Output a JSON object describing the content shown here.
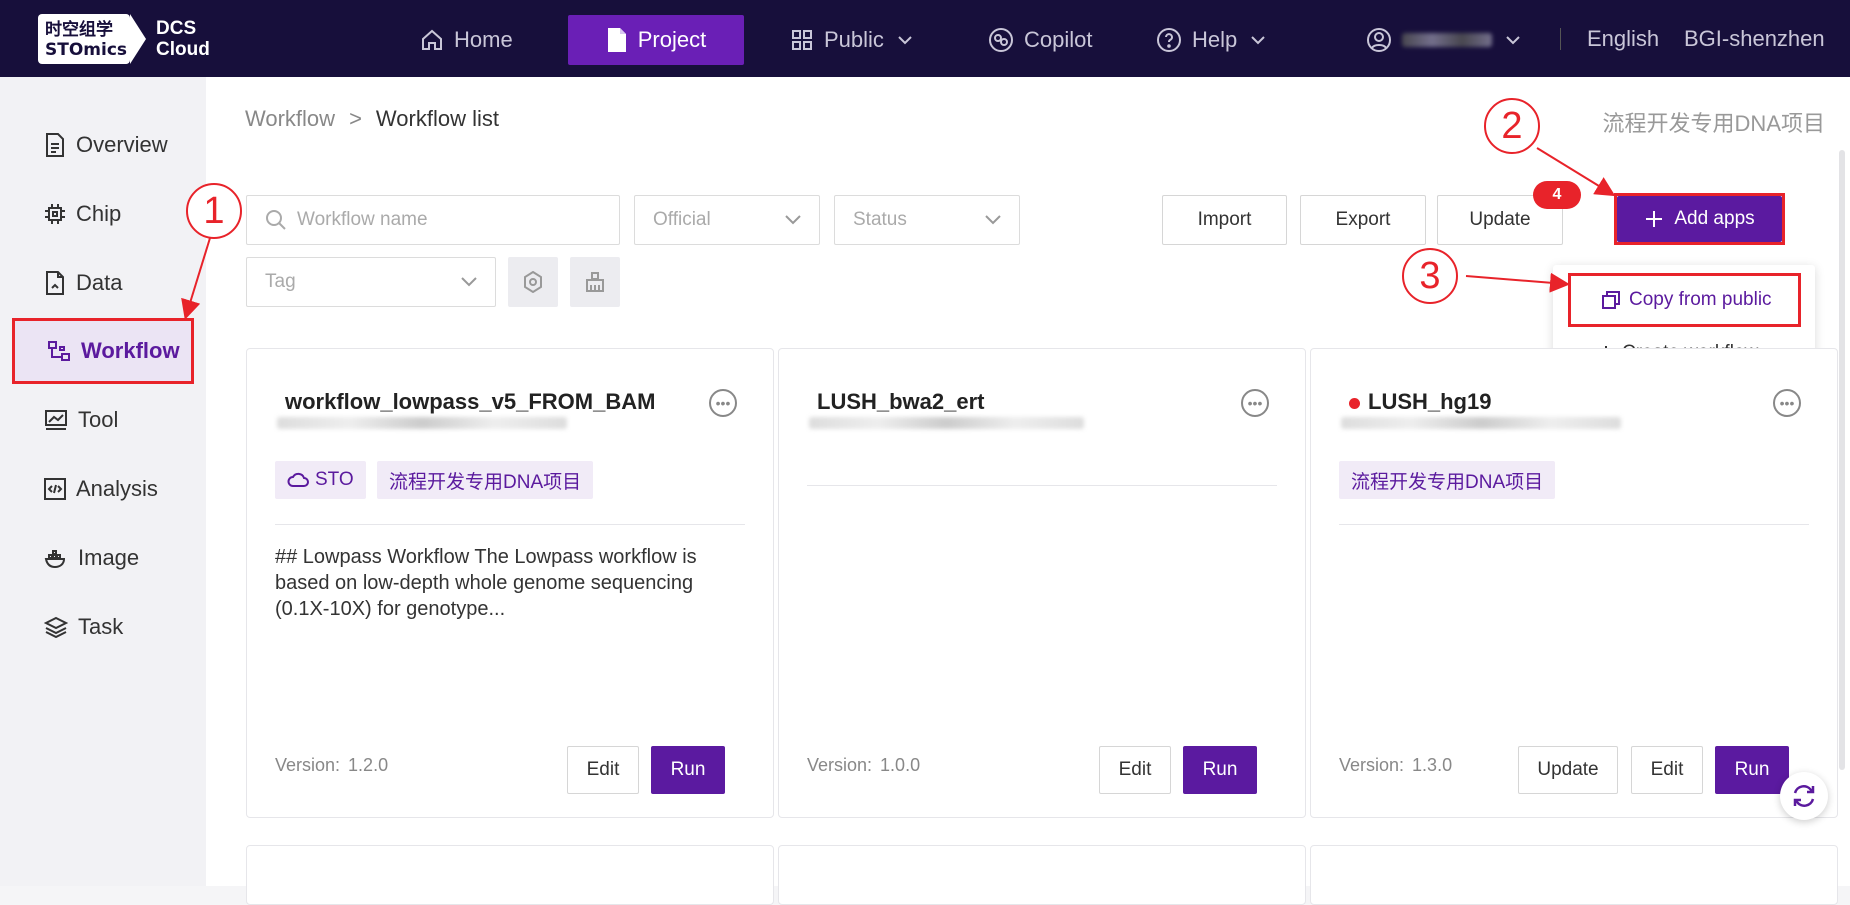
{
  "logo": {
    "cn": "时空组学",
    "en": "STOmics",
    "product_line1": "DCS",
    "product_line2": "Cloud"
  },
  "nav": {
    "home": "Home",
    "project": "Project",
    "public": "Public",
    "copilot": "Copilot",
    "help": "Help",
    "language": "English",
    "org": "BGI-shenzhen"
  },
  "sidebar": {
    "items": [
      {
        "label": "Overview"
      },
      {
        "label": "Chip"
      },
      {
        "label": "Data"
      },
      {
        "label": "Workflow"
      },
      {
        "label": "Tool"
      },
      {
        "label": "Analysis"
      },
      {
        "label": "Image"
      },
      {
        "label": "Task"
      }
    ]
  },
  "breadcrumb": {
    "parent": "Workflow",
    "separator": ">",
    "current": "Workflow list"
  },
  "project_name": "流程开发专用DNA项目",
  "filters": {
    "search_placeholder": "Workflow name",
    "official": "Official",
    "status": "Status",
    "tag": "Tag"
  },
  "toolbar": {
    "import": "Import",
    "export": "Export",
    "update": "Update",
    "update_badge": "4",
    "add_apps": "Add apps"
  },
  "add_menu": {
    "copy_from_public": "Copy from public",
    "create_workflow": "Create workflow"
  },
  "callouts": [
    "1",
    "2",
    "3"
  ],
  "cards": [
    {
      "title": "workflow_lowpass_v5_FROM_BAM",
      "tags": [
        "STO",
        "流程开发专用DNA项目"
      ],
      "description": "## Lowpass Workflow The Lowpass workflow is based on low-depth whole genome sequencing (0.1X-10X) for genotype...",
      "version_label": "Version:",
      "version": "1.2.0",
      "edit": "Edit",
      "run": "Run"
    },
    {
      "title": "LUSH_bwa2_ert",
      "version_label": "Version:",
      "version": "1.0.0",
      "edit": "Edit",
      "run": "Run"
    },
    {
      "title": "LUSH_hg19",
      "tags": [
        "流程开发专用DNA项目"
      ],
      "version_label": "Version:",
      "version": "1.3.0",
      "update": "Update",
      "edit": "Edit",
      "run": "Run"
    }
  ],
  "colors": {
    "topbar": "#170f3b",
    "primary": "#5b1aa0",
    "highlight": "#e8232a"
  }
}
